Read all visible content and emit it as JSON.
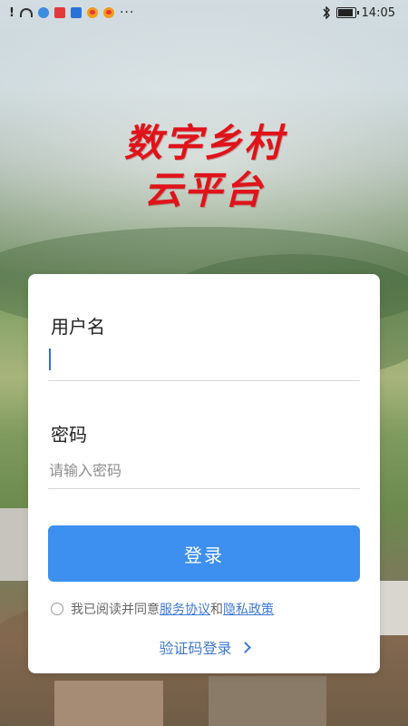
{
  "status_bar": {
    "time": "14:05",
    "more": "···"
  },
  "app": {
    "title_line1": "数字乡村",
    "title_line2": "云平台"
  },
  "login": {
    "username_label": "用户名",
    "username_value": "",
    "password_label": "密码",
    "password_placeholder": "请输入密码",
    "button_label": "登录",
    "agree_prefix": "我已阅读并同意",
    "service_link": "服务协议",
    "and_text": "和",
    "privacy_link": "隐私政策",
    "sms_login_label": "验证码登录"
  },
  "icons": {
    "bluetooth": "bluetooth-icon",
    "battery": "battery-icon",
    "wifi": "wifi-icon",
    "chevron": "chevron-right-icon"
  },
  "colors": {
    "title_red": "#e0131a",
    "primary_blue": "#3d8ff0",
    "link_blue": "#3d78d6"
  }
}
